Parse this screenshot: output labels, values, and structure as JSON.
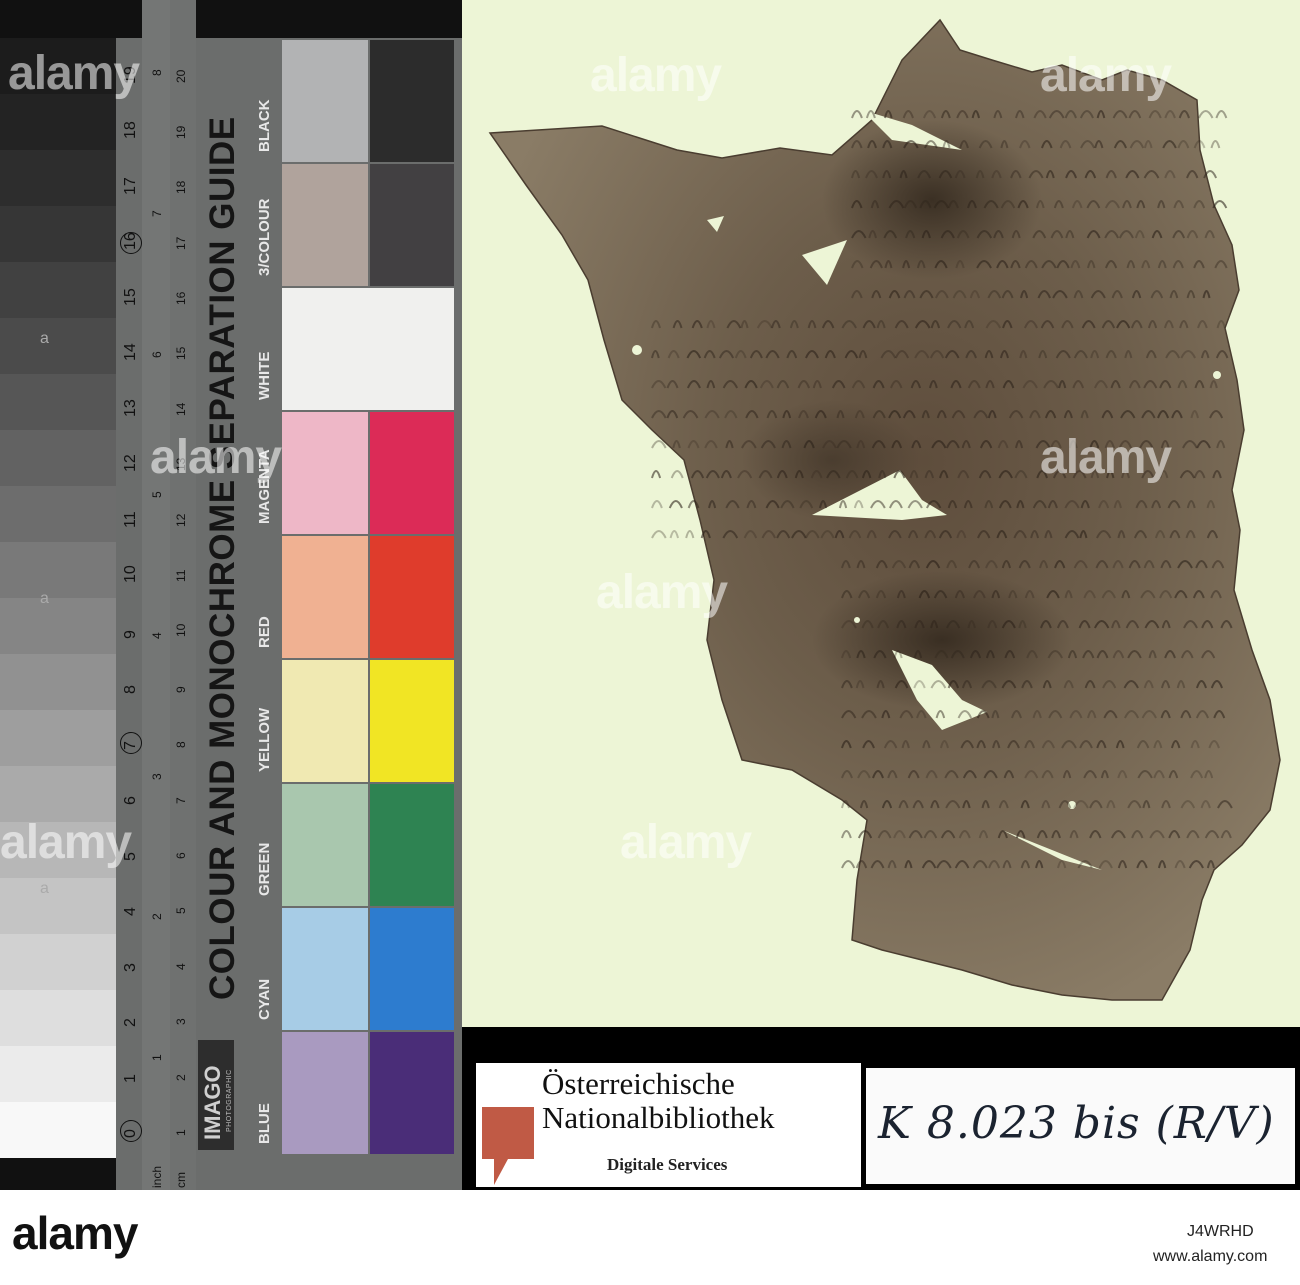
{
  "guide": {
    "title": "COLOUR AND MONOCHROME SEPARATION GUIDE",
    "brand": "IMAGO",
    "brand_sub": "PHOTOGRAPHIC",
    "ruler_label_inch": "inch",
    "ruler_label_cm": "cm",
    "inch_ticks": [
      "1",
      "2",
      "3",
      "4",
      "5",
      "6",
      "7",
      "8"
    ],
    "cm_ticks": [
      "1",
      "2",
      "3",
      "4",
      "5",
      "6",
      "7",
      "8",
      "9",
      "10",
      "11",
      "12",
      "13",
      "14",
      "15",
      "16",
      "17",
      "18",
      "19",
      "20"
    ],
    "step_numbers": [
      "0",
      "1",
      "2",
      "3",
      "4",
      "5",
      "6",
      "7",
      "8",
      "9",
      "10",
      "11",
      "12",
      "13",
      "14",
      "15",
      "16",
      "17",
      "18",
      "19"
    ],
    "step_letter": "a",
    "swatches": [
      {
        "label": "BLUE",
        "light": "#a99ac0",
        "dark": "#4a2d78"
      },
      {
        "label": "CYAN",
        "light": "#a7cce6",
        "dark": "#2d7ccf"
      },
      {
        "label": "GREEN",
        "light": "#a9c7ae",
        "dark": "#2e8352"
      },
      {
        "label": "YELLOW",
        "light": "#f0e9b2",
        "dark": "#f1e524"
      },
      {
        "label": "RED",
        "light": "#f0b192",
        "dark": "#df3c2c"
      },
      {
        "label": "MAGENTA",
        "light": "#eeb7c7",
        "dark": "#dc2b57"
      },
      {
        "label": "WHITE",
        "light": "#f0f0ee",
        "dark": "#f0f0ee"
      },
      {
        "label": "3/COLOUR",
        "light": "#b0a39c",
        "dark": "#424042"
      },
      {
        "label": "BLACK",
        "light": "#b2b3b4",
        "dark": "#2c2c2c"
      }
    ]
  },
  "library": {
    "name_line1": "Österreichische",
    "name_line2": "Nationalbibliothek",
    "department": "Digitale Services",
    "brand_color": "#c05a45"
  },
  "shelfmark": "K 8.023 bis (R/V)",
  "stock": {
    "watermark": "alamy",
    "image_id": "J4WRHD",
    "url": "www.alamy.com"
  },
  "colors": {
    "background_scan": "#edf5d6",
    "fragment": "#7a6a55"
  }
}
